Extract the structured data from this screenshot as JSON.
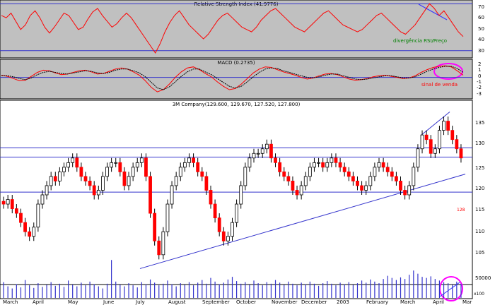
{
  "chart_data": [
    {
      "type": "line",
      "title": "Relative Strength Index (41.9776)",
      "ylim": [
        25,
        72
      ],
      "yticks": [
        "70",
        "60",
        "50",
        "40",
        "30"
      ],
      "reference_lines": [
        70,
        30
      ],
      "series": [
        {
          "name": "",
          "color": "#ff0000",
          "values": [
            60,
            58,
            62,
            55,
            48,
            52,
            60,
            64,
            58,
            50,
            45,
            50,
            56,
            62,
            60,
            54,
            48,
            50,
            57,
            63,
            66,
            60,
            55,
            50,
            53,
            58,
            62,
            58,
            52,
            46,
            40,
            34,
            28,
            36,
            46,
            54,
            60,
            64,
            58,
            52,
            48,
            44,
            40,
            44,
            50,
            56,
            60,
            62,
            58,
            54,
            50,
            48,
            46,
            50,
            56,
            60,
            64,
            66,
            62,
            58,
            54,
            50,
            48,
            46,
            50,
            54,
            58,
            62,
            64,
            60,
            56,
            52,
            50,
            48,
            46,
            48,
            52,
            56,
            60,
            62,
            58,
            54,
            50,
            46,
            44,
            48,
            52,
            58,
            64,
            70,
            66,
            60,
            64,
            58,
            52,
            46,
            42
          ]
        }
      ],
      "annotations": [
        {
          "text": "divergência RSI/Preço",
          "color": "#008000"
        }
      ]
    },
    {
      "type": "line",
      "title": "MACD (0.2735)",
      "ylim": [
        -3.6,
        3.0
      ],
      "yticks": [
        "2",
        "1",
        "0",
        "-1",
        "-2",
        "-3"
      ],
      "series": [
        {
          "name": "",
          "color": "#ff0000",
          "values": [
            0.4,
            0.2,
            -0.2,
            -0.6,
            -0.5,
            0.2,
            0.9,
            1.3,
            1.2,
            0.8,
            0.5,
            0.6,
            0.9,
            1.2,
            1.3,
            1.0,
            0.6,
            0.7,
            1.1,
            1.5,
            1.7,
            1.5,
            1.0,
            0.4,
            -0.6,
            -1.8,
            -2.6,
            -2.2,
            -1.2,
            0.0,
            1.0,
            1.7,
            1.9,
            1.4,
            0.7,
            0.1,
            -0.8,
            -1.6,
            -2.2,
            -2.0,
            -1.2,
            -0.2,
            0.8,
            1.5,
            1.9,
            1.8,
            1.4,
            1.0,
            0.7,
            0.4,
            0.0,
            -0.3,
            -0.1,
            0.3,
            0.6,
            0.7,
            0.5,
            0.1,
            -0.3,
            -0.5,
            -0.4,
            -0.2,
            0.1,
            0.3,
            0.4,
            0.2,
            0.0,
            -0.2,
            -0.1,
            0.3,
            0.9,
            1.4,
            1.8,
            2.0,
            2.1,
            1.9,
            1.2,
            0.4
          ]
        },
        {
          "name": "",
          "color": "#000000",
          "dashed": true,
          "values": [
            0.3,
            0.3,
            0.1,
            -0.2,
            -0.4,
            -0.1,
            0.5,
            0.9,
            1.1,
            0.9,
            0.7,
            0.6,
            0.8,
            1.0,
            1.2,
            1.1,
            0.8,
            0.7,
            0.9,
            1.3,
            1.5,
            1.5,
            1.2,
            0.8,
            0.1,
            -0.9,
            -1.9,
            -2.2,
            -1.7,
            -0.8,
            0.2,
            1.0,
            1.5,
            1.5,
            1.0,
            0.5,
            -0.2,
            -0.9,
            -1.6,
            -1.9,
            -1.6,
            -0.8,
            0.1,
            0.9,
            1.5,
            1.7,
            1.6,
            1.2,
            0.9,
            0.6,
            0.3,
            0.0,
            -0.1,
            0.1,
            0.4,
            0.6,
            0.6,
            0.3,
            0.0,
            -0.3,
            -0.4,
            -0.3,
            -0.1,
            0.1,
            0.3,
            0.3,
            0.1,
            -0.1,
            -0.1,
            0.1,
            0.6,
            1.1,
            1.5,
            1.8,
            2.0,
            2.0,
            1.6,
            0.9
          ]
        }
      ],
      "annotations": [
        {
          "text": "sinal de venda",
          "color": "#ff0000"
        }
      ]
    },
    {
      "type": "candlestick",
      "title": "3M Company(129.600, 129.670, 127.520, 127.800)",
      "ylim": [
        101,
        139
      ],
      "yticks": [
        "135",
        "130",
        "125",
        "120",
        "115",
        "110",
        "105"
      ],
      "x_labels": [
        "March",
        "April",
        "May",
        "June",
        "July",
        "August",
        "September",
        "October",
        "November",
        "December",
        "2003",
        "February",
        "March",
        "April",
        "Mar"
      ],
      "horizontal_lines": [
        130.2,
        128.2,
        120.6
      ],
      "trendlines": [
        {
          "from": [
            "2002-07",
            104
          ],
          "to": [
            "2003-05",
            124.5
          ]
        },
        {
          "from": [
            "2003-03",
            133
          ],
          "to": [
            "2003-04",
            138
          ]
        }
      ],
      "close": [
        118,
        119,
        117,
        116,
        114,
        112,
        111,
        113,
        118,
        120,
        122,
        124,
        123,
        125,
        126,
        127,
        128,
        126,
        124,
        123,
        122,
        120,
        121,
        124,
        126,
        127,
        127,
        125,
        122,
        124,
        126,
        127,
        128,
        124,
        116,
        110,
        107,
        112,
        118,
        122,
        124,
        126,
        127,
        128,
        127,
        125,
        124,
        121,
        118,
        115,
        112,
        110,
        111,
        114,
        118,
        122,
        126,
        128,
        129,
        129,
        130,
        131,
        128,
        127,
        125,
        124,
        123,
        121,
        120,
        122,
        124,
        126,
        127,
        127,
        126,
        127,
        128,
        127,
        126,
        125,
        124,
        123,
        122,
        121,
        122,
        124,
        126,
        127,
        126,
        125,
        124,
        123,
        121,
        120,
        122,
        126,
        130,
        133,
        132,
        129,
        130,
        134,
        136,
        134,
        132,
        130,
        128
      ],
      "last_price_label": "128",
      "annotations": [
        {
          "text": "128",
          "color": "#ff0000"
        }
      ]
    },
    {
      "type": "bar",
      "title": "",
      "ylim": [
        0,
        75000
      ],
      "yticks": [
        "50000"
      ],
      "unit_label": "x100",
      "values": [
        30000,
        22000,
        18000,
        26000,
        20000,
        34000,
        24000,
        19000,
        28000,
        21000,
        25000,
        30000,
        23000,
        27000,
        21000,
        33000,
        25000,
        22000,
        29000,
        24000,
        31000,
        26000,
        22000,
        18000,
        27000,
        72000,
        31000,
        25000,
        22000,
        28000,
        24000,
        20000,
        30000,
        26000,
        35000,
        29000,
        24000,
        27000,
        33000,
        26000,
        22000,
        28000,
        25000,
        30000,
        24000,
        29000,
        34000,
        27000,
        38000,
        31000,
        26000,
        29000,
        35000,
        40000,
        32000,
        27000,
        30000,
        25000,
        33000,
        28000,
        24000,
        30000,
        27000,
        34000,
        29000,
        25000,
        31000,
        27000,
        24000,
        29000,
        26000,
        31000,
        27000,
        23000,
        28000,
        32000,
        27000,
        24000,
        29000,
        26000,
        30000,
        25000,
        28000,
        33000,
        29000,
        35000,
        31000,
        28000,
        36000,
        42000,
        38000,
        34000,
        39000,
        36000,
        44000,
        52000,
        46000,
        40000,
        38000,
        41000,
        36000,
        33000,
        30000,
        28000,
        25000,
        31000,
        27000
      ]
    }
  ]
}
